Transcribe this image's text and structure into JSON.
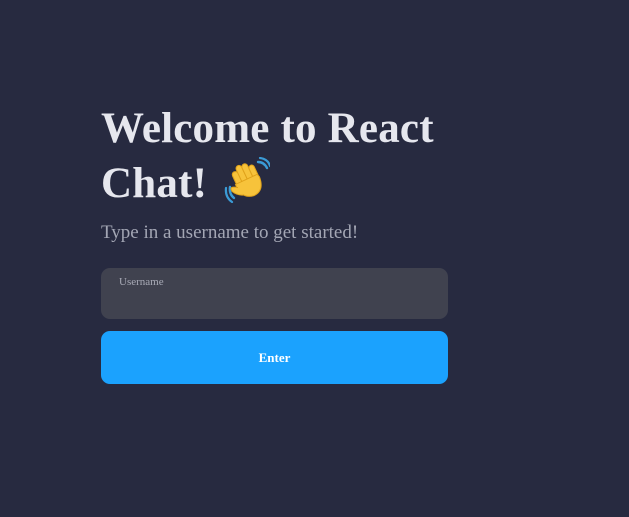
{
  "welcome": {
    "title_line1": "Welcome to React",
    "title_line2": "Chat!",
    "wave_icon": "waving-hand-icon",
    "subtitle": "Type in a username to get started!"
  },
  "form": {
    "username_label": "Username",
    "username_value": "",
    "enter_label": "Enter"
  },
  "colors": {
    "background": "#272a40",
    "input_background": "#40424f",
    "button": "#1ba2fe",
    "title": "#e6e7ee",
    "subtitle": "#a3a6b4"
  }
}
